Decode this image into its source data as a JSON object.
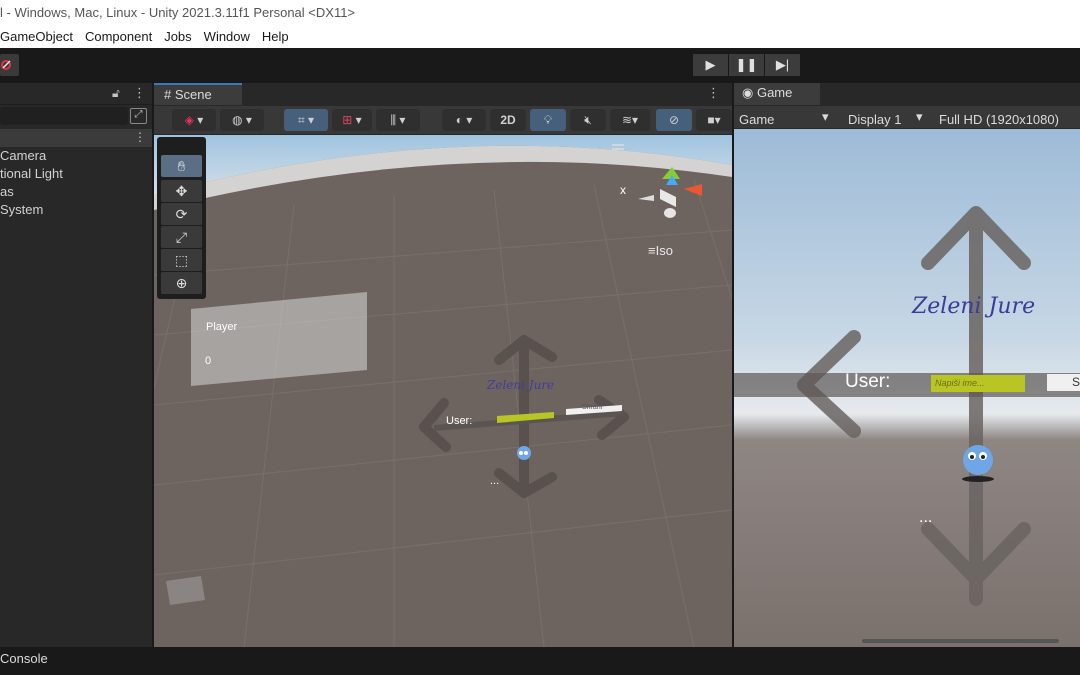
{
  "window": {
    "title": "l - Windows, Mac, Linux - Unity 2021.3.11f1 Personal <DX11>"
  },
  "menu": [
    "GameObject",
    "Component",
    "Jobs",
    "Window",
    "Help"
  ],
  "hierarchy": {
    "items": [
      "Camera",
      "tional Light",
      "as",
      "System"
    ]
  },
  "scene": {
    "tab_label": "Scene",
    "mode_2d": "2D",
    "projection": "Iso",
    "gizmo_axis": "x",
    "ui_panel": {
      "title": "Player",
      "value": "0"
    },
    "world_user_label": "User:",
    "world_button_label": "Shrani",
    "world_ellipsis": "...",
    "world_title": "Zeleni Jure"
  },
  "game": {
    "tab_label": "Game",
    "dropdown_game": "Game",
    "display": "Display 1",
    "resolution": "Full HD (1920x1080)",
    "title_text": "Zeleni Jure",
    "user_label": "User:",
    "input_placeholder": "Napiši ime...",
    "button_label": "S",
    "ellipsis": "..."
  },
  "console": {
    "tab_label": "Console"
  },
  "colors": {
    "accent": "#3a79bb",
    "input_green": "#b8c523",
    "ground": "#6d6460"
  }
}
